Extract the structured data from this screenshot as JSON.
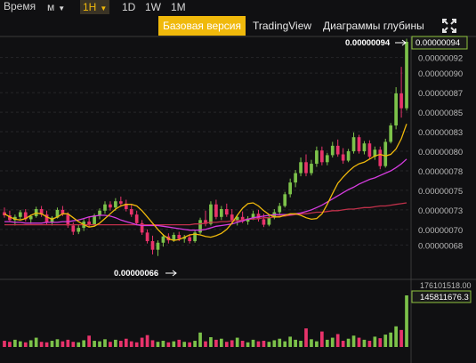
{
  "toolbar": {
    "time_label": "Время",
    "intervals": [
      "м",
      "1H",
      "1D",
      "1W",
      "1M"
    ],
    "active_interval": "1H"
  },
  "views": {
    "basic": "Базовая версия",
    "tradingview": "TradingView",
    "depth": "Диаграммы глубины"
  },
  "icons": {
    "fullscreen": "fullscreen-icon",
    "caret": "caret-down-icon"
  },
  "colors": {
    "up": "#7cc24a",
    "down": "#e8336b",
    "accent": "#f0b90b",
    "ma_fast": "#f0b90b",
    "ma_mid": "#d63ce0",
    "ma_slow": "#c0304a"
  },
  "chart_data": {
    "type": "candlestick",
    "price_axis_labels": [
      "0.00000094",
      "0.00000092",
      "0.00000090",
      "0.00000087",
      "0.00000085",
      "0.00000083",
      "0.00000080",
      "0.00000078",
      "0.00000075",
      "0.00000073",
      "0.00000070",
      "0.00000068"
    ],
    "high_marker": "0.00000094",
    "low_marker": "0.00000066",
    "last_price": "0.00000094",
    "volume_axis_label": "176101518.00",
    "last_volume": "145811676.3",
    "ylim": [
      6.6e-07,
      9.5e-07
    ],
    "ma_fast": [
      72,
      71.6,
      71.3,
      71.2,
      71.4,
      71.8,
      72.1,
      72.0,
      71.6,
      71.3,
      71.6,
      72.0,
      72.0,
      71.5,
      71.0,
      70.6,
      70.3,
      70.4,
      70.8,
      71.4,
      72.0,
      72.6,
      73.0,
      73.2,
      73.2,
      73.0,
      72.4,
      71.6,
      70.8,
      70.0,
      69.3,
      68.8,
      68.6,
      68.7,
      69.0,
      69.3,
      69.4,
      69.3,
      69.1,
      69.0,
      69.2,
      69.5,
      70.0,
      70.8,
      71.8,
      72.7,
      73.3,
      73.4,
      73.0,
      72.4,
      71.9,
      71.6,
      71.6,
      71.8,
      72.0,
      72.0,
      71.8,
      71.5,
      71.3,
      71.4,
      72.0,
      73.2,
      74.6,
      75.9,
      76.7,
      77.4,
      78.0,
      78.4,
      78.6,
      79.0,
      79.4,
      79.6,
      79.4,
      79.6,
      80.3,
      81.6,
      83.5
    ],
    "ma_mid": [
      71.0,
      71.0,
      70.9,
      70.9,
      70.8,
      70.8,
      70.8,
      70.8,
      70.9,
      70.9,
      70.9,
      71.0,
      71.0,
      71.1,
      71.2,
      71.4,
      71.6,
      71.7,
      71.8,
      71.8,
      71.7,
      71.5,
      71.2,
      71.0,
      70.8,
      70.6,
      70.5,
      70.5,
      70.5,
      70.5,
      70.4,
      70.3,
      70.2,
      70.1,
      70.0,
      69.9,
      69.9,
      69.9,
      70.0,
      70.2,
      70.4,
      70.5,
      70.6,
      70.7,
      70.9,
      71.1,
      71.3,
      71.5,
      71.6,
      71.7,
      71.8,
      71.9,
      71.9,
      71.9,
      71.9,
      72.0,
      72.1,
      72.3,
      72.5,
      72.8,
      73.1,
      73.5,
      73.9,
      74.3,
      74.7,
      75.1,
      75.4,
      75.8,
      76.1,
      76.4,
      76.6,
      76.9,
      77.2,
      77.5,
      77.9,
      78.4,
      79.0
    ],
    "ma_slow": [
      70.6,
      70.6,
      70.6,
      70.6,
      70.6,
      70.6,
      70.6,
      70.6,
      70.6,
      70.6,
      70.6,
      70.6,
      70.6,
      70.6,
      70.6,
      70.6,
      70.6,
      70.6,
      70.6,
      70.6,
      70.6,
      70.6,
      70.6,
      70.6,
      70.6,
      70.6,
      70.6,
      70.6,
      70.6,
      70.6,
      70.6,
      70.6,
      70.6,
      70.6,
      70.6,
      70.6,
      70.7,
      70.7,
      70.8,
      70.9,
      70.9,
      71.0,
      71.0,
      71.1,
      71.1,
      71.2,
      71.3,
      71.3,
      71.4,
      71.5,
      71.5,
      71.6,
      71.7,
      71.7,
      71.8,
      71.9,
      72.0,
      72.0,
      72.1,
      72.2,
      72.2,
      72.3,
      72.4,
      72.4,
      72.5,
      72.6,
      72.6,
      72.7,
      72.8,
      72.8,
      72.9,
      73.0,
      73.0,
      73.1,
      73.2,
      73.3,
      73.4
    ],
    "candles": [
      [
        72.2,
        72.8,
        71.5,
        71.8
      ],
      [
        71.8,
        72.4,
        71.0,
        71.2
      ],
      [
        71.2,
        71.9,
        70.5,
        71.6
      ],
      [
        71.6,
        72.5,
        71.3,
        72.2
      ],
      [
        72.2,
        72.6,
        71.0,
        71.3
      ],
      [
        71.3,
        71.9,
        70.7,
        71.7
      ],
      [
        71.7,
        72.9,
        71.5,
        72.6
      ],
      [
        72.6,
        73.0,
        71.6,
        71.9
      ],
      [
        71.9,
        72.4,
        70.6,
        70.9
      ],
      [
        70.9,
        71.7,
        70.5,
        71.5
      ],
      [
        71.5,
        72.8,
        71.4,
        72.5
      ],
      [
        72.5,
        73.0,
        71.7,
        71.9
      ],
      [
        71.9,
        72.2,
        70.2,
        70.5
      ],
      [
        70.5,
        70.9,
        69.3,
        69.7
      ],
      [
        69.7,
        70.6,
        69.4,
        70.2
      ],
      [
        70.2,
        71.3,
        69.8,
        71.0
      ],
      [
        71.0,
        71.6,
        70.3,
        70.6
      ],
      [
        70.6,
        72.0,
        70.4,
        71.8
      ],
      [
        71.8,
        72.7,
        71.3,
        72.4
      ],
      [
        72.4,
        73.6,
        72.0,
        73.2
      ],
      [
        73.2,
        73.6,
        72.4,
        72.8
      ],
      [
        72.8,
        74.0,
        72.4,
        73.6
      ],
      [
        73.6,
        74.2,
        72.9,
        73.3
      ],
      [
        73.3,
        73.8,
        72.3,
        72.6
      ],
      [
        72.6,
        73.2,
        71.6,
        71.9
      ],
      [
        71.9,
        72.4,
        70.6,
        70.8
      ],
      [
        70.8,
        71.2,
        69.3,
        69.6
      ],
      [
        69.6,
        70.0,
        68.2,
        68.5
      ],
      [
        68.5,
        69.2,
        66.8,
        67.4
      ],
      [
        67.4,
        68.6,
        66.6,
        68.3
      ],
      [
        68.3,
        69.4,
        67.8,
        69.1
      ],
      [
        69.1,
        69.5,
        68.2,
        68.6
      ],
      [
        68.6,
        69.6,
        68.4,
        69.3
      ],
      [
        69.3,
        69.7,
        68.5,
        68.8
      ],
      [
        68.8,
        69.3,
        68.3,
        69.0
      ],
      [
        69.0,
        69.4,
        68.2,
        68.5
      ],
      [
        68.5,
        69.9,
        68.3,
        69.6
      ],
      [
        69.6,
        71.5,
        69.4,
        71.2
      ],
      [
        71.2,
        72.4,
        70.4,
        70.7
      ],
      [
        70.7,
        73.6,
        70.5,
        73.2
      ],
      [
        73.2,
        73.8,
        71.3,
        71.6
      ],
      [
        71.6,
        73.0,
        71.2,
        72.6
      ],
      [
        72.6,
        73.3,
        71.6,
        71.9
      ],
      [
        71.9,
        72.6,
        70.8,
        71.2
      ],
      [
        71.2,
        71.9,
        70.5,
        71.6
      ],
      [
        71.6,
        72.3,
        70.8,
        71.0
      ],
      [
        71.0,
        71.7,
        70.6,
        71.4
      ],
      [
        71.4,
        72.4,
        71.2,
        72.0
      ],
      [
        72.0,
        72.5,
        71.0,
        71.3
      ],
      [
        71.3,
        72.0,
        70.3,
        70.6
      ],
      [
        70.6,
        71.8,
        70.4,
        71.5
      ],
      [
        71.5,
        72.6,
        71.3,
        72.2
      ],
      [
        72.2,
        73.4,
        71.9,
        73.0
      ],
      [
        73.0,
        74.8,
        72.8,
        74.5
      ],
      [
        74.5,
        76.5,
        74.1,
        76.0
      ],
      [
        76.0,
        77.6,
        75.4,
        77.2
      ],
      [
        77.2,
        79.2,
        76.8,
        78.6
      ],
      [
        78.6,
        79.6,
        76.8,
        77.2
      ],
      [
        77.2,
        78.9,
        76.9,
        78.4
      ],
      [
        78.4,
        80.6,
        78.0,
        80.1
      ],
      [
        80.1,
        80.6,
        78.2,
        78.6
      ],
      [
        78.6,
        79.8,
        78.2,
        79.5
      ],
      [
        79.5,
        81.2,
        79.2,
        80.7
      ],
      [
        80.7,
        81.5,
        79.3,
        79.6
      ],
      [
        79.6,
        80.4,
        78.4,
        78.8
      ],
      [
        78.8,
        80.3,
        78.6,
        80.0
      ],
      [
        80.0,
        82.4,
        79.7,
        81.8
      ],
      [
        81.8,
        82.1,
        79.7,
        80.0
      ],
      [
        80.0,
        81.3,
        79.6,
        81.0
      ],
      [
        81.0,
        81.4,
        79.0,
        79.3
      ],
      [
        79.3,
        80.6,
        78.9,
        80.2
      ],
      [
        80.2,
        80.6,
        77.7,
        78.1
      ],
      [
        78.1,
        81.6,
        77.9,
        81.2
      ],
      [
        81.2,
        83.6,
        81.0,
        83.3
      ],
      [
        83.3,
        88.2,
        82.8,
        87.4
      ],
      [
        87.4,
        90.8,
        84.3,
        85.5
      ],
      [
        85.5,
        94.4,
        85.2,
        94.0
      ]
    ],
    "volumes": [
      12,
      10,
      14,
      11,
      9,
      13,
      18,
      10,
      9,
      12,
      15,
      11,
      14,
      10,
      9,
      13,
      22,
      12,
      11,
      15,
      10,
      14,
      12,
      16,
      11,
      9,
      18,
      23,
      13,
      10,
      12,
      9,
      11,
      14,
      10,
      9,
      12,
      28,
      11,
      19,
      14,
      16,
      10,
      13,
      18,
      12,
      9,
      14,
      11,
      12,
      10,
      13,
      16,
      11,
      20,
      14,
      12,
      36,
      15,
      11,
      30,
      14,
      18,
      25,
      12,
      16,
      22,
      18,
      14,
      12,
      20,
      17,
      24,
      28,
      40,
      33,
      100
    ]
  }
}
